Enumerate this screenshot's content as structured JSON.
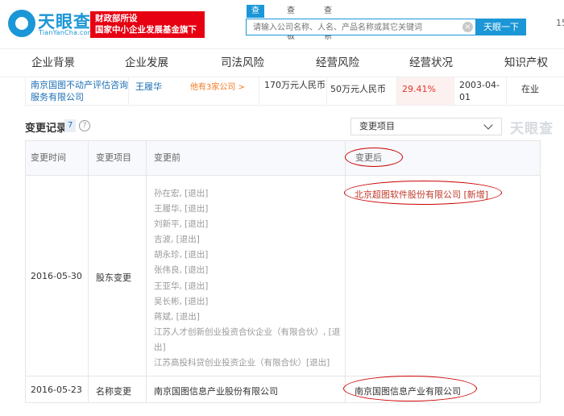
{
  "header": {
    "logo_text": "天眼查",
    "logo_sub": "TianYanCha.com",
    "gov_banner": [
      "财政部所设",
      "国家中小企业发展基金旗下"
    ],
    "search_tabs": [
      "查公司",
      "查老板",
      "查关系"
    ],
    "search_placeholder": "请输入公司名称、人名、产品名称或其它关键词",
    "search_button": "天眼一下",
    "edge_text": "15"
  },
  "nav": {
    "items": [
      "企业背景",
      "企业发展",
      "司法风险",
      "经营风险",
      "经营状况",
      "知识产权"
    ]
  },
  "summary_row": {
    "company": "南京国图不动产评估咨询服务有限公司",
    "person": "王履华",
    "other_companies": "他有3家公司 >",
    "amount": "170万元人民币",
    "capital": "50万元人民币",
    "percent": "29.41%",
    "date": "2003-04-01",
    "status": "在业"
  },
  "section": {
    "title": "变更记录",
    "count": "7",
    "help": "?",
    "filter_value": "变更项目",
    "watermark": "天眼查"
  },
  "table": {
    "headers": [
      "变更时间",
      "变更项目",
      "变更前",
      "变更后"
    ],
    "rows": [
      {
        "date": "2016-05-30",
        "item": "股东变更",
        "before": [
          "孙在宏, [退出]",
          "王履华, [退出]",
          "刘新平, [退出]",
          "吉波, [退出]",
          "胡永珍, [退出]",
          "张伟良, [退出]",
          "王亚华, [退出]",
          "吴长彬, [退出]",
          "蒋斌, [退出]",
          "江苏人才创新创业投资合伙企业（有限合伙）, [退",
          "出]",
          "江苏高投科贷创业投资企业（有限合伙）[退出]"
        ],
        "after": "北京超图软件股份有限公司 [新增]"
      },
      {
        "date": "2016-05-23",
        "item": "名称变更",
        "before_text": "南京国图信息产业股份有限公司",
        "after": "南京国图信息产业有限公司"
      }
    ]
  },
  "colors": {
    "brand_blue": "#1b96d6",
    "banner_red": "#e60012",
    "link_blue": "#1b6eb6",
    "percent_red": "#e6332a",
    "annotation_red": "#cc0000"
  }
}
